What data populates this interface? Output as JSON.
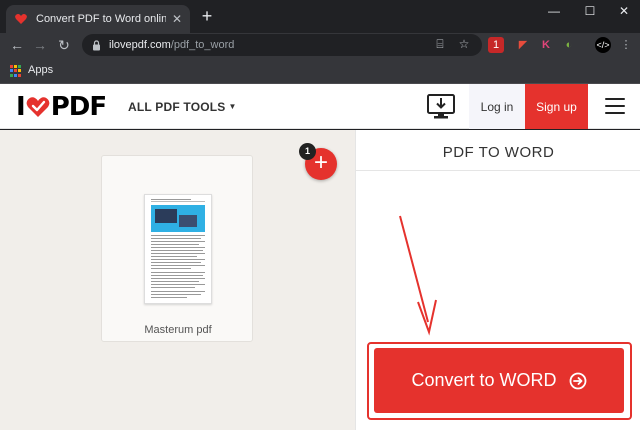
{
  "browser": {
    "tab_title": "Convert PDF to Word online. Free",
    "new_tab": "+",
    "window_controls": {
      "minimize": "—",
      "maximize": "☐",
      "close": "✕"
    },
    "url_host": "ilovepdf.com",
    "url_path": "/pdf_to_word",
    "bookmarks": {
      "apps_label": "Apps"
    },
    "extensions": {
      "ext1_badge": "1",
      "ext2_letter": "K"
    },
    "accent": "#35363a"
  },
  "site": {
    "logo": {
      "left": "I",
      "right": "PDF"
    },
    "tools_label": "ALL PDF TOOLS",
    "login_label": "Log in",
    "signup_label": "Sign up",
    "brand_color": "#e5322d"
  },
  "workspace": {
    "add_badge": "1",
    "add_label": "+",
    "file_name": "Masterum pdf"
  },
  "panel": {
    "title": "PDF TO WORD",
    "convert_label": "Convert to WORD"
  }
}
